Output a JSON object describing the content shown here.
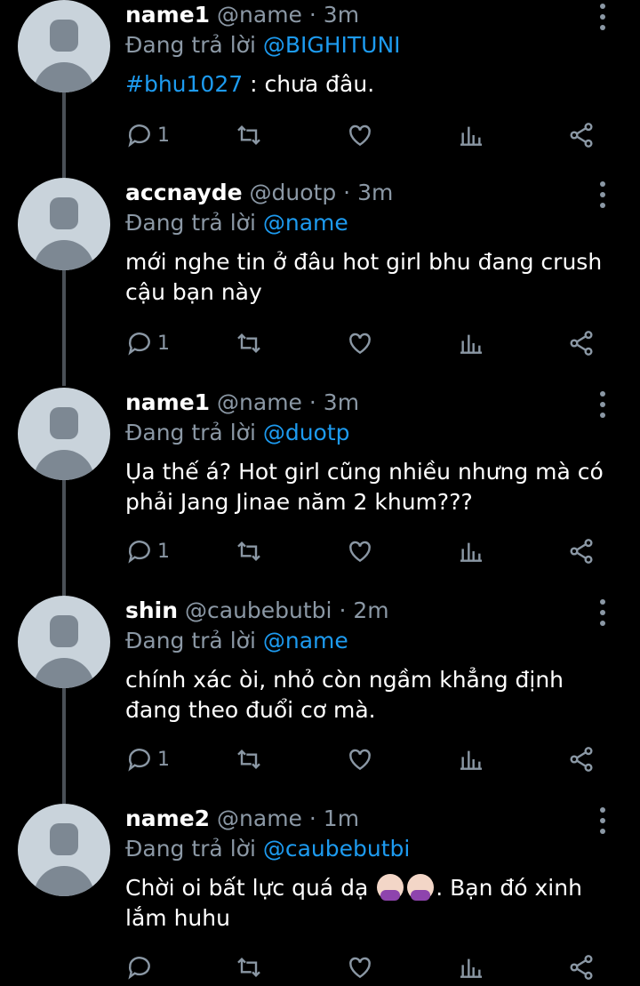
{
  "reply_prefix": "Đang trả lời",
  "tweets": [
    {
      "name": "name1",
      "handle": "@name",
      "time": "3m",
      "reply_to": "@BIGHITUNI",
      "tag": "#bhu1027",
      "text": " : chưa đâu.",
      "reply_count": "1"
    },
    {
      "name": "accnayde",
      "handle": "@duotp",
      "time": "3m",
      "reply_to": "@name",
      "text": "mới nghe tin ở đâu hot girl bhu đang crush cậu bạn này",
      "reply_count": "1"
    },
    {
      "name": "name1",
      "handle": "@name",
      "time": "3m",
      "reply_to": "@duotp",
      "text": "Ụa thế á? Hot girl cũng nhiều nhưng mà có phải Jang Jinae năm 2 khum???",
      "reply_count": "1"
    },
    {
      "name": "shin",
      "handle": "@caubebutbi",
      "time": "2m",
      "reply_to": "@name",
      "text": "chính xác òi, nhỏ còn ngầm khẳng định đang theo đuổi cơ mà.",
      "reply_count": "1"
    },
    {
      "name": "name2",
      "handle": "@name",
      "time": "1m",
      "reply_to": "@caubebutbi",
      "text_before": "Chời oi bất lực quá dạ ",
      "emoji": "woman-facepalming",
      "text_after": ". Bạn đó xinh lắm huhu",
      "reply_count": ""
    }
  ],
  "colors": {
    "accent": "#1d9bf0",
    "muted": "#8b98a5",
    "background": "#000000"
  },
  "icons": [
    "reply-icon",
    "retweet-icon",
    "like-icon",
    "analytics-icon",
    "share-icon",
    "more-icon"
  ]
}
